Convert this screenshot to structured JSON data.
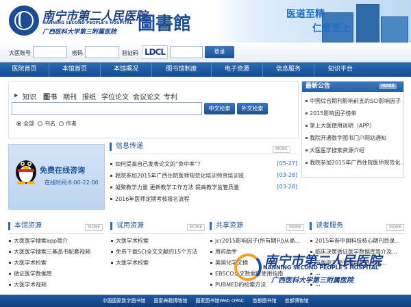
{
  "header": {
    "hospital_name": "南宁市第二人民医院",
    "hospital_name_en": "NANNING SECOND PEOPLE'S HOSPITAL",
    "hospital_sub": "广西医科大学第三附属医院",
    "library_title": "圖書館",
    "motto_1": "医道至精",
    "motto_2": "仁爱至上"
  },
  "login": {
    "account_label": "大医账号",
    "password_label": "密码",
    "captcha_label": "验证码",
    "captcha_text": "LDCL",
    "login_button": "登录"
  },
  "nav": [
    "医院首页",
    "本馆首页",
    "本馆概况",
    "图书馆制度",
    "电子资源",
    "信息服务",
    "知识平台"
  ],
  "search": {
    "tabs": [
      "知识",
      "图书",
      "期刊",
      "报纸",
      "学位论文",
      "会议论文",
      "专利"
    ],
    "active_tab": "图书",
    "btn_cn": "中文检索",
    "btn_foreign": "外文检索",
    "radio_all": "全部",
    "radio_title": "书名",
    "radio_author": "作者"
  },
  "news": {
    "title": "最新公告",
    "more": "MORE",
    "items": [
      "中国综合期刊影响前五的SCI影响因子",
      "2015影响因子榜单",
      "掌上大医使用说明（APP）",
      "我院开通数字图书门户网站通知",
      "大医医学搜索资源介绍",
      "我院参加2015年广西住院医师规范化..."
    ]
  },
  "consult": {
    "title": "免费在线咨询",
    "time": "在线时间:8:00-22:00"
  },
  "info": {
    "title": "信息传递",
    "more": "MORE",
    "items": [
      {
        "text": "如何提高自己发表论文的“命中率”？",
        "date": "[05-27]"
      },
      {
        "text": "我院参加2015年广西住院医师规范化培训师资培训班",
        "date": "[03-28]"
      },
      {
        "text": "凝聚教学力量 更新教学工作方法 提高教学监管质量",
        "date": "[03-28]"
      },
      {
        "text": "2016年医师定期考核报名流程",
        "date": "[03-28]"
      }
    ]
  },
  "sections": [
    {
      "title": "本馆资源",
      "more": "MORE",
      "items": [
        "大医医学搜索app简介",
        "大医医学搜索三基品书配套视频",
        "大医学术检索",
        "循证医学数据库",
        "大医学术视频"
      ]
    },
    {
      "title": "试用资源",
      "more": "MORE",
      "items": [
        "大医学术检索",
        "免费下载SCI全文文献的15个方法",
        "大医学术检索"
      ]
    },
    {
      "title": "共享资源",
      "more": "MORE",
      "items": [
        "jcr2015影响因子(所有期刊)从高...",
        "用药助手",
        "美国化学文摘",
        "EBSCO全文数据库使用指南",
        "PUBMED的检索方法"
      ]
    },
    {
      "title": "读者服务",
      "more": "MORE",
      "items": [
        "2015年新中国科技核心期刊目录...",
        "临床决策循证医学数据库简介及...",
        "新版中文期刊服务平台的检...",
        "...",
        "..."
      ]
    }
  ],
  "footer": [
    "中国国家数字图书馆",
    "国家典籍博物馆",
    "国家图书馆Web OPAC",
    "首都图书馆",
    "首都博物馆"
  ],
  "overlay": {
    "name": "南宁市第二人民医院",
    "name_en": "NANNING SECOND PEOPLE'S HOSPITAL",
    "sub": "广西医科大学第三附属医院"
  },
  "colors": {
    "primary": "#1b4f98",
    "nav": "#2c69b4",
    "accent": "#f1a12b"
  }
}
